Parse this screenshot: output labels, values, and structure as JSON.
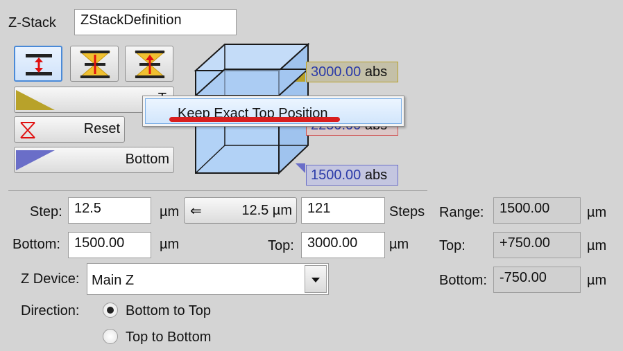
{
  "zstack": {
    "label": "Z-Stack",
    "definition_value": "ZStackDefinition"
  },
  "buttons": {
    "top_label": "T",
    "reset_label": "Reset",
    "bottom_label": "Bottom"
  },
  "cube": {
    "top_value": "3000.00",
    "top_unit": "abs",
    "center_value": "2250.00",
    "center_unit": "abs",
    "bottom_value": "1500.00",
    "bottom_unit": "abs"
  },
  "popup": {
    "item_label": "Keep Exact Top Position"
  },
  "params": {
    "step_label": "Step:",
    "step_value": "12.5",
    "step_unit": "µm",
    "step_button_label": "12.5 µm",
    "steps_value": "121",
    "steps_label": "Steps",
    "bottom_label": "Bottom:",
    "bottom_value": "1500.00",
    "bottom_unit": "µm",
    "top_label": "Top:",
    "top_value": "3000.00",
    "top_unit": "µm",
    "zdevice_label": "Z Device:",
    "zdevice_value": "Main Z",
    "direction_label": "Direction:",
    "direction_options": [
      "Bottom to Top",
      "Top to Bottom"
    ],
    "direction_selected": "Bottom to Top"
  },
  "summary": {
    "range_label": "Range:",
    "range_value": "1500.00",
    "range_unit": "µm",
    "top_label": "Top:",
    "top_value": "+750.00",
    "top_unit": "µm",
    "bottom_label": "Bottom:",
    "bottom_value": "-750.00",
    "bottom_unit": "µm"
  },
  "colors": {
    "top_marker": "#b8a22a",
    "bottom_marker": "#6a6ec8",
    "center_marker": "#d05050",
    "highlight": "#d81e1e"
  }
}
